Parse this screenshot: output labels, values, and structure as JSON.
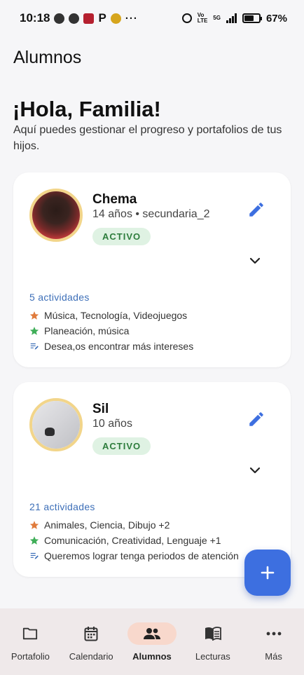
{
  "status_bar": {
    "time": "10:18",
    "notification_overflow": "···",
    "net_top": "Vo",
    "net_bottom": "LTE",
    "net_gen": "5G",
    "battery": "67%"
  },
  "header": {
    "title": "Alumnos",
    "greeting": "¡Hola, Familia!",
    "subtitle": "Aquí puedes gestionar el progreso y portafolios de tus hijos."
  },
  "students": [
    {
      "name": "Chema",
      "meta": "14 años • secundaria_2",
      "status": "ACTIVO",
      "activities": "5 actividades",
      "interests": "Música, Tecnología, Videojuegos",
      "skills": "Planeación, música",
      "goals": "Desea,os encontrar más intereses"
    },
    {
      "name": "Sil",
      "meta": "10 años",
      "status": "ACTIVO",
      "activities": "21 actividades",
      "interests": "Animales, Ciencia, Dibujo +2",
      "skills": "Comunicación, Creatividad, Lenguaje +1",
      "goals": "Queremos lograr tenga periodos de atención"
    }
  ],
  "fab": {
    "icon": "plus-icon"
  },
  "nav": [
    {
      "label": "Portafolio",
      "icon": "folder-icon",
      "active": false
    },
    {
      "label": "Calendario",
      "icon": "calendar-icon",
      "active": false
    },
    {
      "label": "Alumnos",
      "icon": "people-icon",
      "active": true
    },
    {
      "label": "Lecturas",
      "icon": "book-icon",
      "active": false
    },
    {
      "label": "Más",
      "icon": "more-icon",
      "active": false
    }
  ],
  "colors": {
    "accent": "#3d6fe0",
    "active_badge_bg": "#dff2e3",
    "active_badge_text": "#2e7d3d",
    "interest_star": "#e07b3c",
    "skill_star": "#3fae58",
    "link_blue": "#3d6fb8",
    "nav_active_pill": "#f8d8cc"
  }
}
